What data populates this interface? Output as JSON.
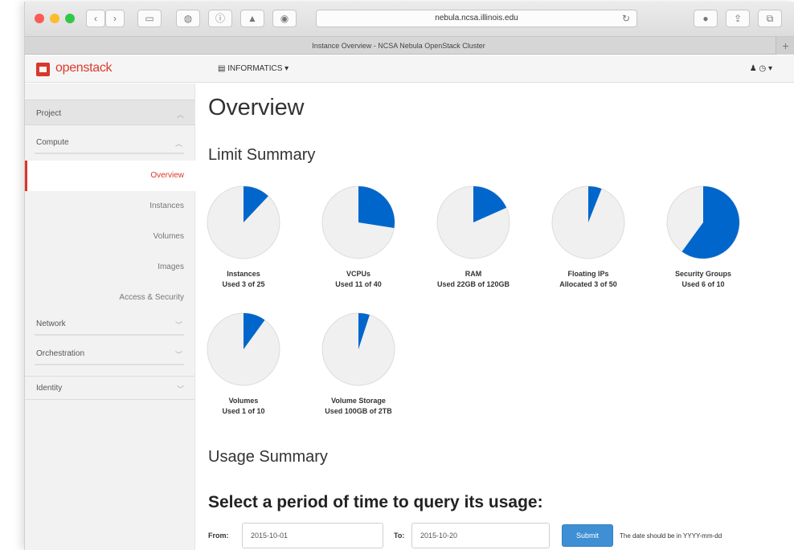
{
  "browser": {
    "url": "nebula.ncsa.illinois.edu",
    "tab_title": "Instance Overview - NCSA Nebula OpenStack Cluster",
    "new_tab": "+",
    "reload_icon": "reload-icon"
  },
  "header": {
    "logo_text": "openstack",
    "project": "▤ INFORMATICS ▾",
    "user_menu": "♟ ◷ ▾",
    "accent_color": "#d9372a"
  },
  "sidebar": {
    "project": "Project",
    "compute": "Compute",
    "items": [
      {
        "label": "Overview",
        "active": true
      },
      {
        "label": "Instances",
        "active": false
      },
      {
        "label": "Volumes",
        "active": false
      },
      {
        "label": "Images",
        "active": false
      },
      {
        "label": "Access & Security",
        "active": false
      }
    ],
    "network": "Network",
    "orchestration": "Orchestration",
    "identity": "Identity"
  },
  "main": {
    "title": "Overview",
    "limit_summary": "Limit Summary",
    "usage_summary": "Usage Summary",
    "query_title": "Select a period of time to query its usage:",
    "form": {
      "from_label": "From:",
      "from_value": "2015-10-01",
      "to_label": "To:",
      "to_value": "2015-10-20",
      "submit": "Submit",
      "hint": "The date should be in YYYY-mm-dd"
    }
  },
  "chart_data": {
    "type": "pie",
    "fill_color": "#0066cc",
    "empty_color": "#f0f0f0",
    "limits": [
      {
        "name": "Instances",
        "used_text": "Used 3 of 25",
        "used": 3,
        "total": 25
      },
      {
        "name": "VCPUs",
        "used_text": "Used 11 of 40",
        "used": 11,
        "total": 40
      },
      {
        "name": "RAM",
        "used_text": "Used 22GB of 120GB",
        "used": 22,
        "total": 120
      },
      {
        "name": "Floating IPs",
        "used_text": "Allocated 3 of 50",
        "used": 3,
        "total": 50
      },
      {
        "name": "Security Groups",
        "used_text": "Used 6 of 10",
        "used": 6,
        "total": 10
      },
      {
        "name": "Volumes",
        "used_text": "Used 1 of 10",
        "used": 1,
        "total": 10
      },
      {
        "name": "Volume Storage",
        "used_text": "Used 100GB of 2TB",
        "used": 0.1,
        "total": 2
      }
    ]
  }
}
